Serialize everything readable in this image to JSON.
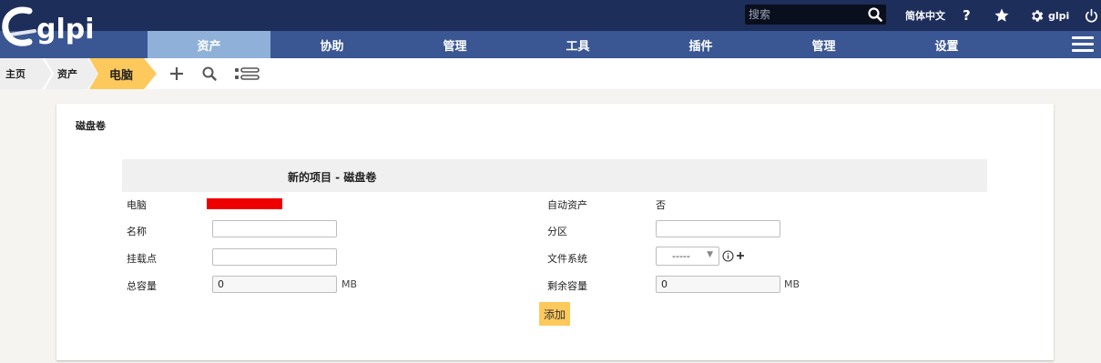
{
  "header": {
    "logo_text": "glpi",
    "search": {
      "placeholder": "搜索",
      "value": ""
    },
    "language_label": "简体中文",
    "help_label": "?",
    "profile_label": "glpi"
  },
  "nav": {
    "items": [
      {
        "label": "资产"
      },
      {
        "label": "协助"
      },
      {
        "label": "管理"
      },
      {
        "label": "工具"
      },
      {
        "label": "插件"
      },
      {
        "label": "管理"
      },
      {
        "label": "设置"
      }
    ]
  },
  "breadcrumb": {
    "items": [
      {
        "label": "主页"
      },
      {
        "label": "资产"
      },
      {
        "label": "电脑"
      }
    ]
  },
  "colors": {
    "topbar": "#1e2e5b",
    "navbar": "#3a5693",
    "nav_active": "#8fb0d8",
    "breadcrumb_active": "#fec95c",
    "add_button": "#fec95c"
  },
  "card": {
    "title": "磁盘卷",
    "form_title": "新的项目 - 磁盘卷",
    "fields": {
      "computer_label": "电脑",
      "auto_asset_label": "自动资产",
      "auto_asset_value": "否",
      "name_label": "名称",
      "name_value": "",
      "partition_label": "分区",
      "partition_value": "",
      "mountpoint_label": "挂载点",
      "mountpoint_value": "",
      "filesystem_label": "文件系统",
      "filesystem_value": "-----",
      "total_label": "总容量",
      "total_value": "0",
      "total_unit": "MB",
      "free_label": "剩余容量",
      "free_value": "0",
      "free_unit": "MB"
    },
    "add_label": "添加"
  }
}
